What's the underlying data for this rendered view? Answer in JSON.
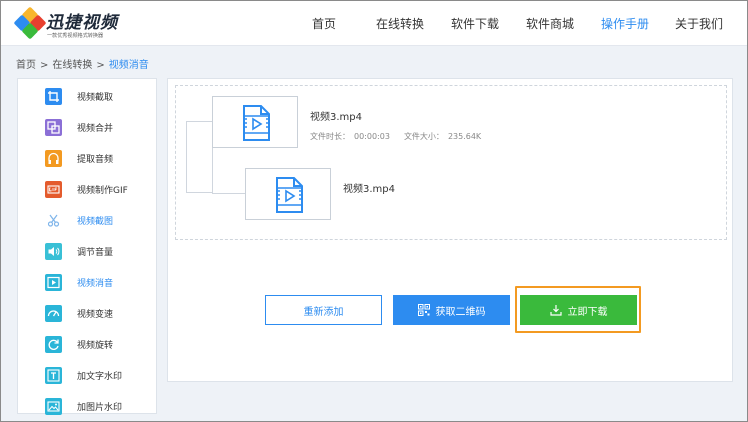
{
  "header": {
    "logo_name": "迅捷视频",
    "logo_slogan": "一款优秀视频格式转换器",
    "nav": [
      {
        "label": "首页",
        "active": false
      },
      {
        "label": "在线转换",
        "active": false
      },
      {
        "label": "软件下载",
        "active": false
      },
      {
        "label": "软件商城",
        "active": false
      },
      {
        "label": "操作手册",
        "active": true
      },
      {
        "label": "关于我们",
        "active": false
      }
    ]
  },
  "breadcrumb": [
    "首页",
    "在线转换",
    "视频消音"
  ],
  "breadcrumb_sep": ">",
  "sidebar": {
    "items": [
      {
        "label": "视频截取",
        "icon": "crop-icon",
        "color": "#2d8cf0",
        "active": false
      },
      {
        "label": "视频合并",
        "icon": "merge-icon",
        "color": "#8b6fd6",
        "active": false
      },
      {
        "label": "提取音频",
        "icon": "headphones-icon",
        "color": "#f39a21",
        "active": false
      },
      {
        "label": "视频制作GIF",
        "icon": "gif-icon",
        "color": "#e45b2d",
        "active": false
      },
      {
        "label": "视频截图",
        "icon": "scissors-icon",
        "color": "#7fb5ea",
        "active": true
      },
      {
        "label": "调节音量",
        "icon": "volume-icon",
        "color": "#39c0d6",
        "active": false
      },
      {
        "label": "视频消音",
        "icon": "play-square-icon",
        "color": "#2ab5d8",
        "active": true
      },
      {
        "label": "视频变速",
        "icon": "speedometer-icon",
        "color": "#2ab5d8",
        "active": false
      },
      {
        "label": "视频旋转",
        "icon": "rotate-icon",
        "color": "#2ab5d8",
        "active": false
      },
      {
        "label": "加文字水印",
        "icon": "text-icon",
        "color": "#2ab5d8",
        "active": false
      },
      {
        "label": "加图片水印",
        "icon": "image-icon",
        "color": "#2ab5d8",
        "active": false
      }
    ]
  },
  "files": {
    "source": {
      "name": "视频3.mp4",
      "duration_label": "文件时长：",
      "duration": "00:00:03",
      "size_label": "文件大小：",
      "size": "235.64K"
    },
    "output": {
      "name": "视频3.mp4"
    }
  },
  "buttons": {
    "readd": "重新添加",
    "qrcode": "获取二维码",
    "download": "立即下载"
  },
  "colors": {
    "accent": "#2d8cf0",
    "download": "#3aba3c",
    "highlight": "#f39a21"
  }
}
